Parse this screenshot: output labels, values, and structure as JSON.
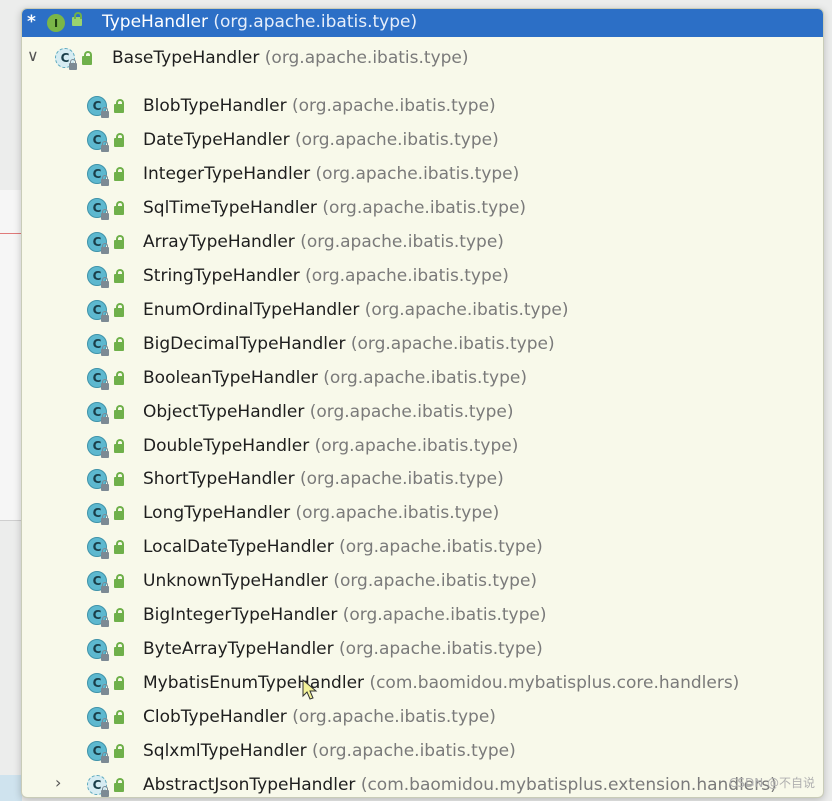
{
  "header": {
    "star": "*",
    "interface_icon_letter": "I",
    "title_name": "TypeHandler",
    "title_package": "(org.apache.ibatis.type)"
  },
  "tree": {
    "root": {
      "name": "BaseTypeHandler",
      "package": "(org.apache.ibatis.type)",
      "icon_letter": "C",
      "expanded": true
    },
    "children": [
      {
        "name": "BlobTypeHandler",
        "package": "(org.apache.ibatis.type)"
      },
      {
        "name": "DateTypeHandler",
        "package": "(org.apache.ibatis.type)"
      },
      {
        "name": "IntegerTypeHandler",
        "package": "(org.apache.ibatis.type)"
      },
      {
        "name": "SqlTimeTypeHandler",
        "package": "(org.apache.ibatis.type)"
      },
      {
        "name": "ArrayTypeHandler",
        "package": "(org.apache.ibatis.type)"
      },
      {
        "name": "StringTypeHandler",
        "package": "(org.apache.ibatis.type)"
      },
      {
        "name": "EnumOrdinalTypeHandler",
        "package": "(org.apache.ibatis.type)"
      },
      {
        "name": "BigDecimalTypeHandler",
        "package": "(org.apache.ibatis.type)"
      },
      {
        "name": "BooleanTypeHandler",
        "package": "(org.apache.ibatis.type)"
      },
      {
        "name": "ObjectTypeHandler",
        "package": "(org.apache.ibatis.type)"
      },
      {
        "name": "DoubleTypeHandler",
        "package": "(org.apache.ibatis.type)"
      },
      {
        "name": "ShortTypeHandler",
        "package": "(org.apache.ibatis.type)"
      },
      {
        "name": "LongTypeHandler",
        "package": "(org.apache.ibatis.type)"
      },
      {
        "name": "LocalDateTypeHandler",
        "package": "(org.apache.ibatis.type)"
      },
      {
        "name": "UnknownTypeHandler",
        "package": "(org.apache.ibatis.type)"
      },
      {
        "name": "BigIntegerTypeHandler",
        "package": "(org.apache.ibatis.type)"
      },
      {
        "name": "ByteArrayTypeHandler",
        "package": "(org.apache.ibatis.type)"
      },
      {
        "name": "MybatisEnumTypeHandler",
        "package": "(com.baomidou.mybatisplus.core.handlers)"
      },
      {
        "name": "ClobTypeHandler",
        "package": "(org.apache.ibatis.type)"
      },
      {
        "name": "SqlxmlTypeHandler",
        "package": "(org.apache.ibatis.type)"
      },
      {
        "name": "AbstractJsonTypeHandler",
        "package": "(com.baomidou.mybatisplus.extension.handlers)",
        "expandable": true
      }
    ],
    "class_icon_letter": "C"
  },
  "watermark": "CSDN @不自说",
  "colors": {
    "header_bg": "#2c6fc6",
    "popup_bg": "#f8f9ea",
    "class_icon": "#5db8cf",
    "lock_green": "#6fb04a",
    "package_text": "#7a7a7a"
  }
}
